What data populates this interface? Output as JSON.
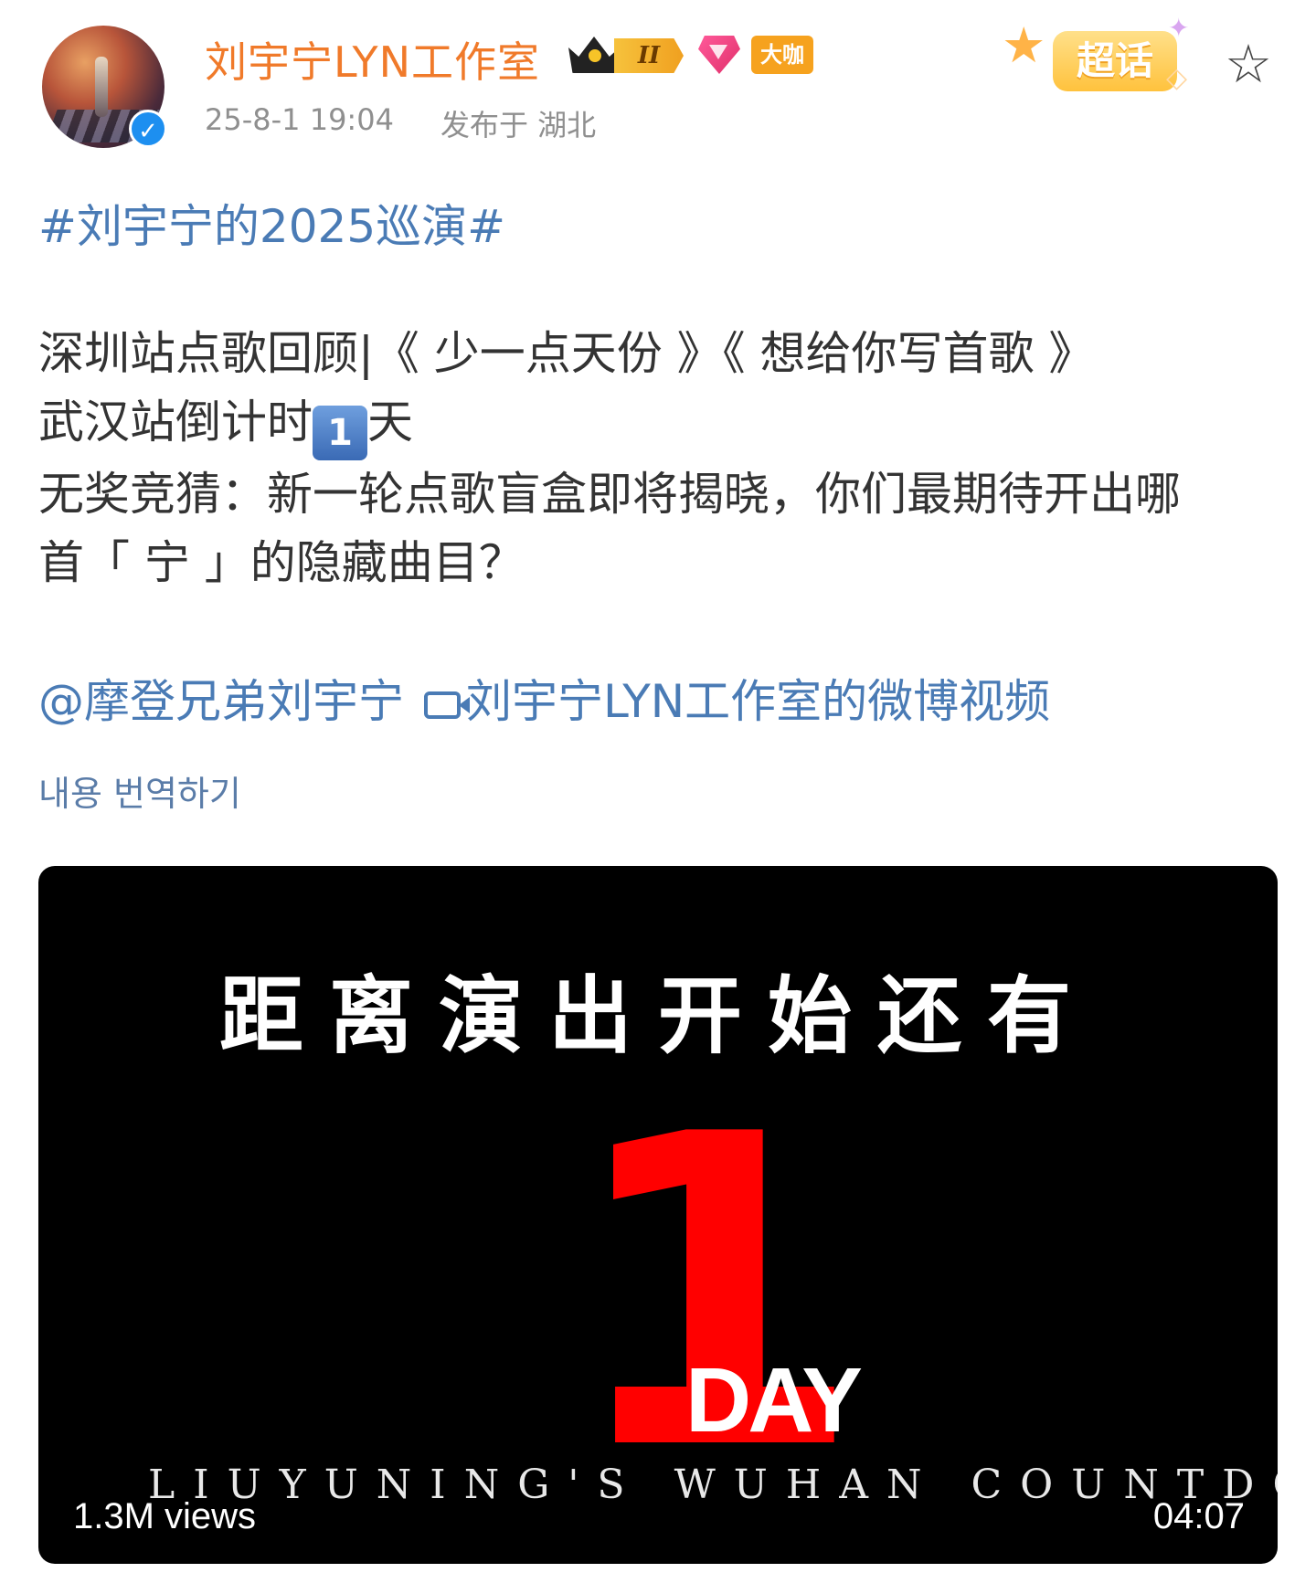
{
  "post": {
    "author": "刘宇宁LYN工作室",
    "level_badge": "II",
    "daka_badge": "大咖",
    "datetime": "25-8-1 19:04",
    "location": "发布于 湖北",
    "supertopic_label": "超话",
    "hashtag": "#刘宇宁的2025巡演#",
    "lines": [
      "深圳站点歌回顾|《 少一点天份 》《 想给你写首歌 》",
      "武汉站倒计时",
      "1",
      "天",
      "无奖竞猜：新一轮点歌盲盒即将揭晓，你们最期待开出哪",
      "首「 宁 」的隐藏曲目？"
    ],
    "mention": "@摩登兄弟刘宇宁",
    "video_link": "刘宇宁LYN工作室的微博视频",
    "translate": "내용 번역하기"
  },
  "video": {
    "headline": "距离演出开始还有",
    "big_number": "1",
    "unit": "DAY",
    "subtitle": "LIUYUNING'S WUHAN COUNTDOWN",
    "views": "1.3M views",
    "duration": "04:07"
  },
  "icons": {
    "verified": "verified-check-icon",
    "star": "favorite-star-icon",
    "video": "video-camera-icon"
  },
  "colors": {
    "author": "#f07a2a",
    "link": "#4a7bb5",
    "countdown_red": "#ff0000"
  }
}
